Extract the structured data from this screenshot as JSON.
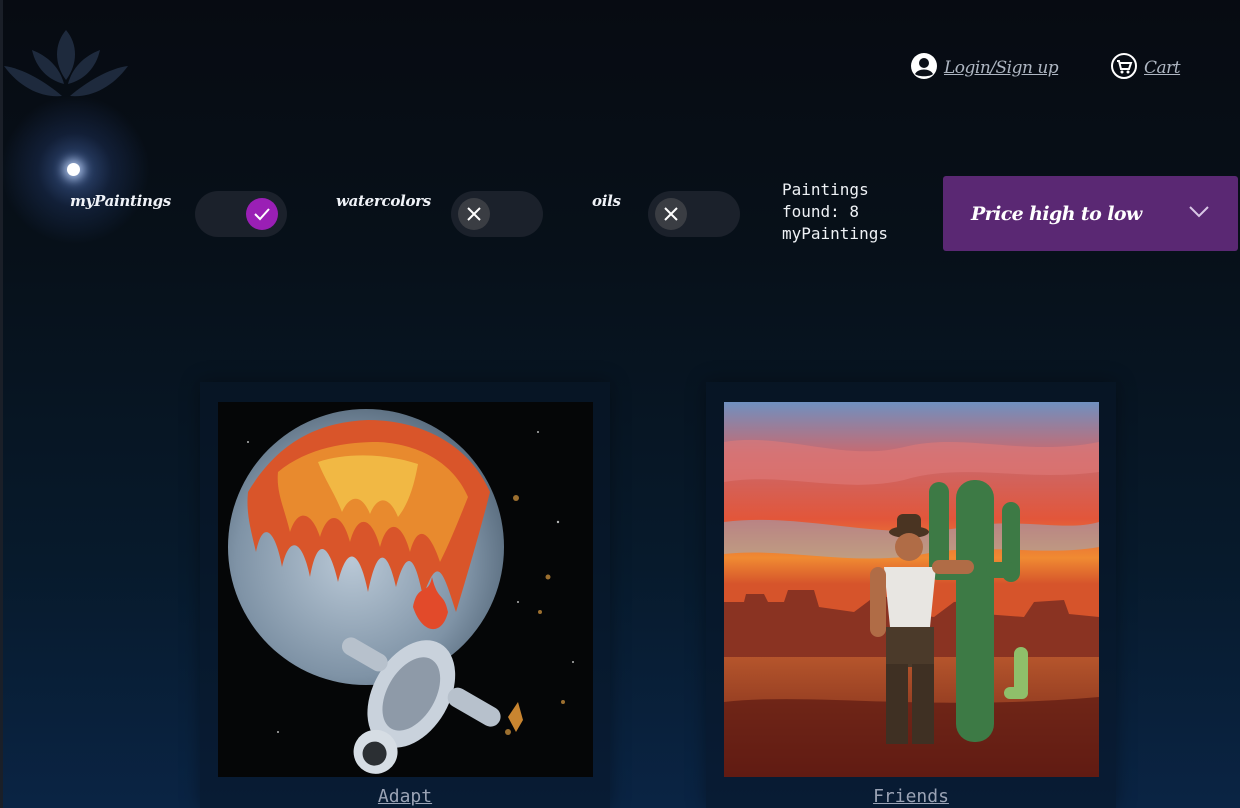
{
  "nav": {
    "login_label": "Login/Sign up",
    "cart_label": "Cart"
  },
  "filters": {
    "items": [
      {
        "label": "myPaintings",
        "checked": true
      },
      {
        "label": "watercolors",
        "checked": false
      },
      {
        "label": "oils",
        "checked": false
      }
    ]
  },
  "results": {
    "text": "Paintings\nfound: 8\nmyPaintings"
  },
  "sort": {
    "selected": "Price high to low"
  },
  "gallery": {
    "paintings": [
      {
        "title": "Adapt"
      },
      {
        "title": "Friends"
      }
    ]
  },
  "colors": {
    "accent_purple": "#9a1fb5",
    "sort_bg": "#5a2873",
    "toggle_bg": "#1b212b"
  },
  "icons": [
    "lotus-logo-icon",
    "user-circle-icon",
    "cart-icon",
    "check-icon",
    "close-icon",
    "chevron-down-icon"
  ]
}
